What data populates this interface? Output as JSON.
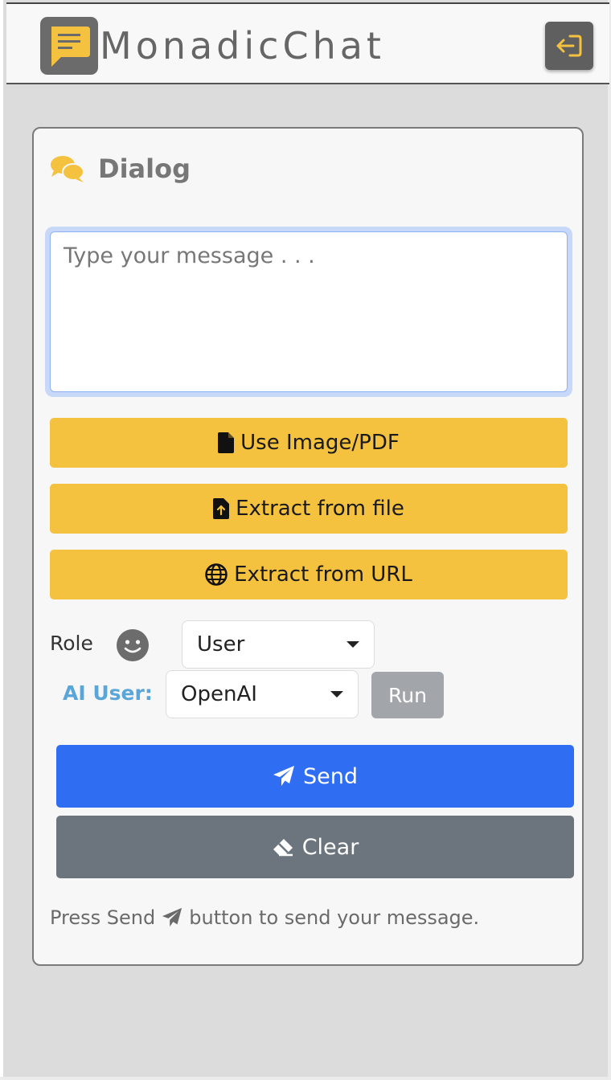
{
  "header": {
    "brand": "MonadicChat",
    "logo_icon": "chat-bubble-icon",
    "logout_icon": "logout-icon",
    "colors": {
      "logo_bg": "#6b6b6b",
      "logo_bubble": "#f5c23f",
      "logout_bg": "#5f5f5f",
      "logout_icon": "#f5c23f"
    }
  },
  "dialog": {
    "title": "Dialog",
    "title_icon": "comments-icon",
    "message": {
      "value": "",
      "placeholder": "Type your message . . ."
    },
    "actions": {
      "use_image_pdf": "Use Image/PDF",
      "extract_from_file": "Extract from file",
      "extract_from_url": "Extract from URL"
    },
    "role": {
      "label": "Role",
      "icon": "smiley-icon",
      "selected": "User"
    },
    "ai_user": {
      "label": "AI User:",
      "selected": "OpenAI",
      "run_label": "Run"
    },
    "send_label": "Send",
    "clear_label": "Clear",
    "hint_before": "Press Send",
    "hint_after": "button to send your message.",
    "colors": {
      "accent_yellow": "#f5c23f",
      "send_blue": "#2f6ef2",
      "clear_gray": "#6c757d",
      "ai_user_label": "#5aa6d8",
      "run_gray": "#a2a6ab"
    }
  }
}
